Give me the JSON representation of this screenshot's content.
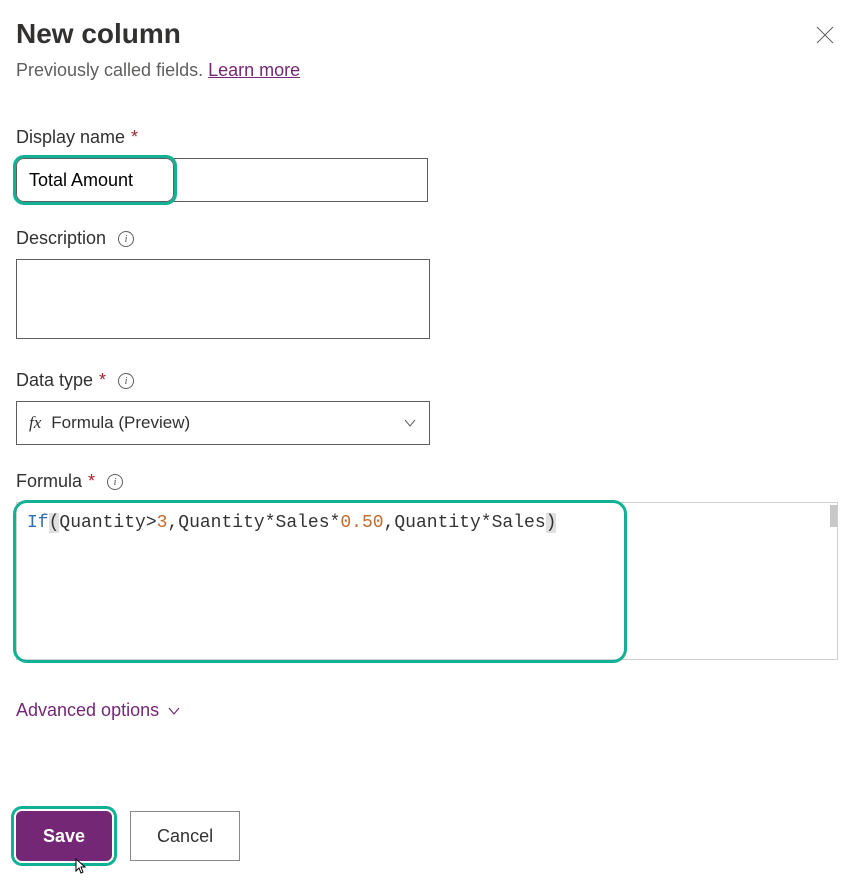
{
  "header": {
    "title": "New column",
    "subtitle_prefix": "Previously called fields. ",
    "learn_more": "Learn more"
  },
  "fields": {
    "displayName": {
      "label": "Display name",
      "value": "Total Amount"
    },
    "description": {
      "label": "Description",
      "value": ""
    },
    "dataType": {
      "label": "Data type",
      "value": "Formula (Preview)"
    },
    "formula": {
      "label": "Formula",
      "tokens": {
        "if": "If",
        "p1": "(",
        "quantity": "Quantity",
        "gt": ">",
        "three": "3",
        "comma": ",",
        "star": "*",
        "sales": "Sales",
        "rate": "0.50",
        "p2": ")"
      }
    }
  },
  "advanced": {
    "label": "Advanced options"
  },
  "footer": {
    "save": "Save",
    "cancel": "Cancel"
  }
}
